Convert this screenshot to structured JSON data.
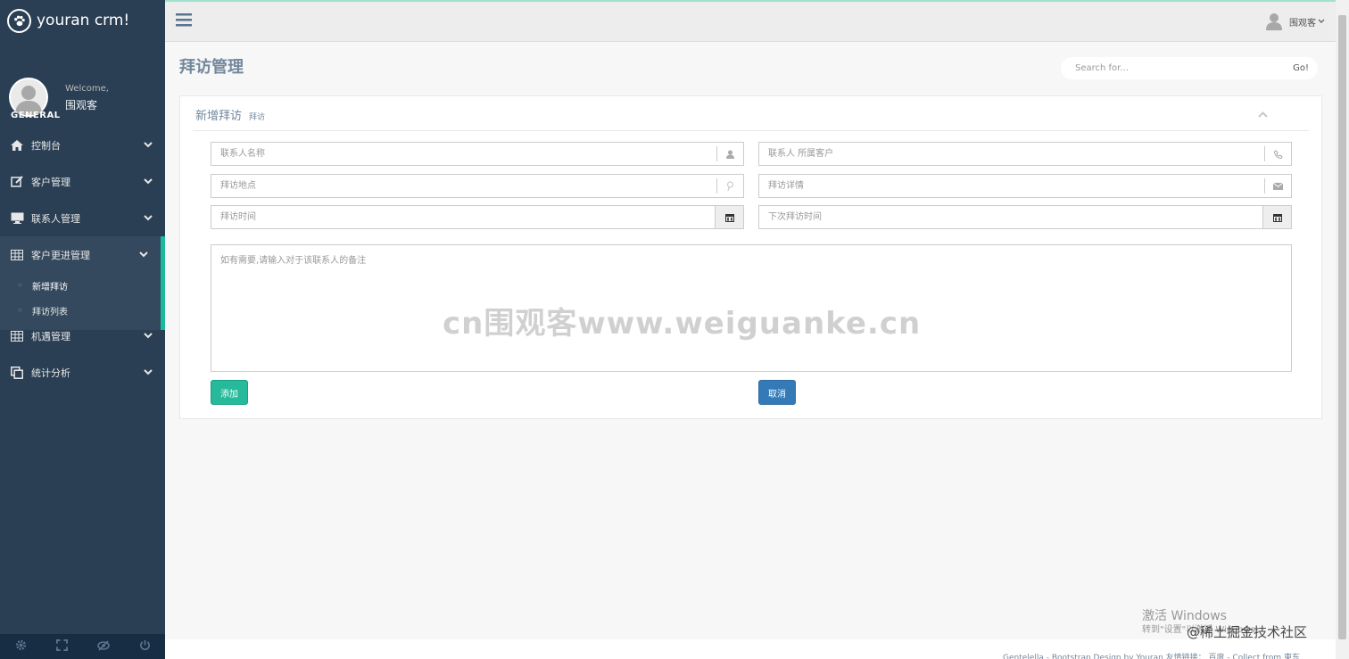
{
  "brand": {
    "title": "youran crm!"
  },
  "profile": {
    "welcome": "Welcome,",
    "name": "围观客"
  },
  "sidebar": {
    "section": "GENERAL",
    "items": [
      {
        "label": "控制台",
        "icon": "home-icon"
      },
      {
        "label": "客户管理",
        "icon": "edit-icon"
      },
      {
        "label": "联系人管理",
        "icon": "desktop-icon"
      },
      {
        "label": "客户更进管理",
        "icon": "table-icon"
      },
      {
        "label": "机遇管理",
        "icon": "table-icon"
      },
      {
        "label": "统计分析",
        "icon": "clone-icon"
      }
    ],
    "subitems": [
      {
        "label": "新增拜访"
      },
      {
        "label": "拜访列表"
      }
    ]
  },
  "topnav": {
    "user": "围观客"
  },
  "page": {
    "title": "拜访管理"
  },
  "search": {
    "placeholder": "Search for...",
    "go": "Go!"
  },
  "panel": {
    "title": "新增拜访",
    "subtitle": "拜访"
  },
  "form": {
    "contact_name": "联系人名称",
    "contact_customer": "联系人 所属客户",
    "visit_place": "拜访地点",
    "visit_detail": "拜访详情",
    "visit_time": "拜访时间",
    "next_visit_time": "下次拜访时间",
    "notes": "如有需要,请输入对于该联系人的备注"
  },
  "buttons": {
    "add": "添加",
    "cancel": "取消"
  },
  "watermark": "cn围观客www.weiguanke.cn",
  "footer": {
    "text": "Gentelella - Bootstrap Design by Youran 友情链接： 百度 - Collect from 東东"
  },
  "overlay": {
    "activate_title": "激活 Windows",
    "activate_sub": "转到\"设置\"以激活 Windows。",
    "juejin": "@稀土掘金技术社区"
  },
  "colors": {
    "sidebar": "#2a3f54",
    "accent": "#1abb9c",
    "add_button": "#26b99a",
    "cancel_button": "#337ab7"
  }
}
